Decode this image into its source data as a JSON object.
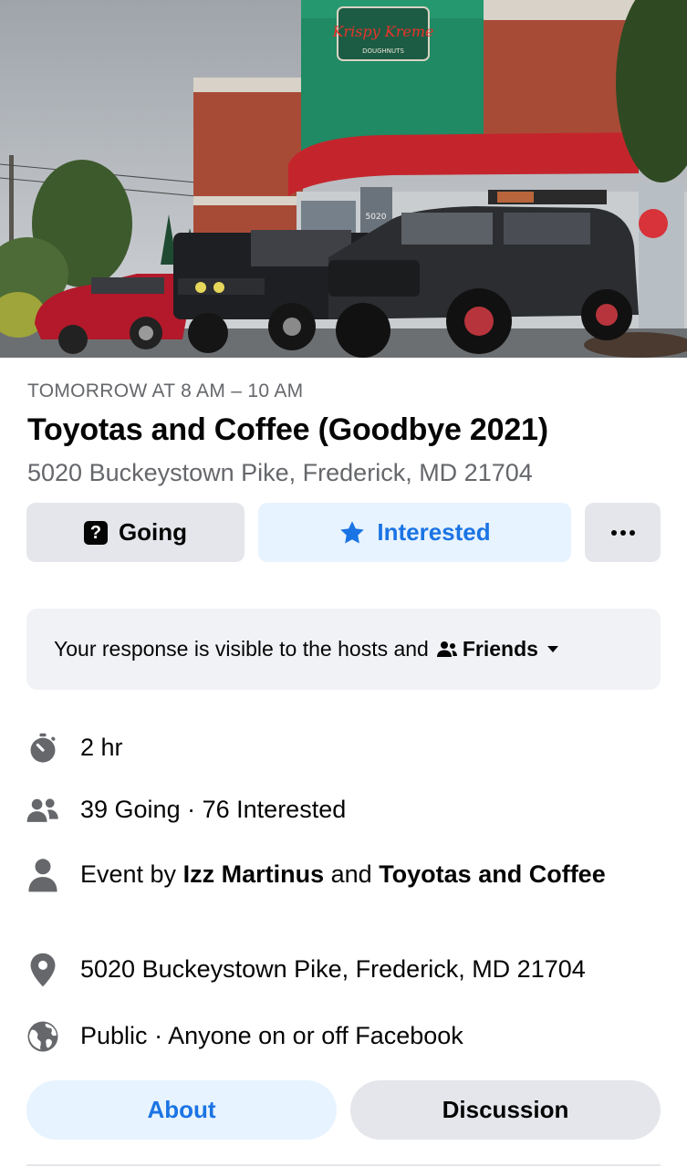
{
  "event": {
    "date_time": "TOMORROW AT 8 AM – 10 AM",
    "title": "Toyotas and Coffee (Goodbye 2021)",
    "address": "5020 Buckeystown Pike, Frederick, MD 21704"
  },
  "cover": {
    "sign_text": "Krispy Kreme",
    "sign_sub": "DOUGHNUTS",
    "door_number": "5020"
  },
  "actions": {
    "going_label": "Going",
    "interested_label": "Interested"
  },
  "visibility": {
    "text": "Your response is visible to the hosts and",
    "audience": "Friends"
  },
  "details": {
    "duration": "2 hr",
    "going_count": "39 Going",
    "separator": "·",
    "interested_count": "76 Interested",
    "host_prefix": "Event by",
    "host_1": "Izz Martinus",
    "host_joiner": "and",
    "host_2": "Toyotas and Coffee",
    "location": "5020 Buckeystown Pike, Frederick, MD 21704",
    "privacy": "Public",
    "privacy_detail": "Anyone on or off Facebook"
  },
  "tabs": {
    "about": "About",
    "discussion": "Discussion"
  },
  "colors": {
    "accent": "#1b74e4",
    "accent_bg": "#e7f3ff",
    "button_gray": "#e4e6eb",
    "secondary_text": "#65676b",
    "icon_gray": "#65676b"
  }
}
